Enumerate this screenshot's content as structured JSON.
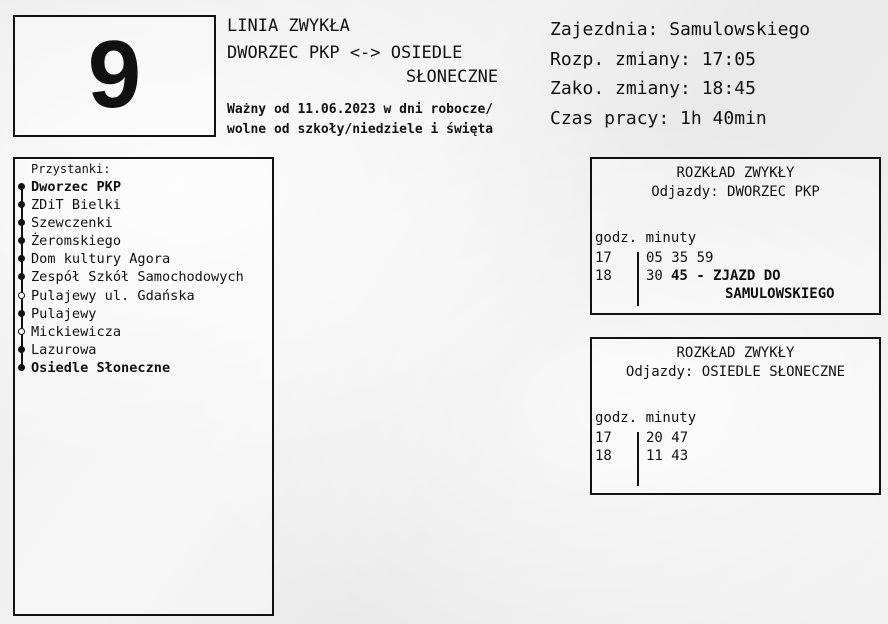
{
  "line": {
    "number": "9",
    "type": "LINIA ZWYKŁA",
    "route_line1": "DWORZEC PKP <-> OSIEDLE",
    "route_line2": "SŁONECZNE",
    "validity_line1": "Ważny od 11.06.2023 w dni robocze/",
    "validity_line2": "wolne od szkoły/niedziele i święta"
  },
  "shift": {
    "depot": "Zajezdnia: Samulowskiego",
    "start": "Rozp. zmiany: 17:05",
    "end": "Zako. zmiany: 18:45",
    "work_time": "Czas pracy: 1h 40min"
  },
  "stops": {
    "title": "Przystanki:",
    "items": [
      {
        "name": "Dworzec PKP",
        "bold": true,
        "on_request": false
      },
      {
        "name": "ZDiT Bielki",
        "bold": false,
        "on_request": false
      },
      {
        "name": "Szewczenki",
        "bold": false,
        "on_request": false
      },
      {
        "name": "Żeromskiego",
        "bold": false,
        "on_request": false
      },
      {
        "name": "Dom kultury Agora",
        "bold": false,
        "on_request": false
      },
      {
        "name": "Zespół Szkół Samochodowych",
        "bold": false,
        "on_request": false
      },
      {
        "name": "Pulajewy ul. Gdańska",
        "bold": false,
        "on_request": true
      },
      {
        "name": "Pulajewy",
        "bold": false,
        "on_request": false
      },
      {
        "name": "Mickiewicza",
        "bold": false,
        "on_request": true
      },
      {
        "name": "Lazurowa",
        "bold": false,
        "on_request": false
      },
      {
        "name": "Osiedle Słoneczne",
        "bold": true,
        "on_request": false
      }
    ]
  },
  "timetables": [
    {
      "title": "ROZKŁAD ZWYKŁY",
      "direction": "Odjazdy: DWORZEC PKP",
      "columns": "godz. minuty",
      "rows": [
        {
          "hour": "17",
          "minutes": "05 35 59"
        },
        {
          "hour": "18",
          "minutes": "30"
        }
      ],
      "note_line1": "45 - ZJAZD DO",
      "note_line2": "SAMULOWSKIEGO"
    },
    {
      "title": "ROZKŁAD ZWYKŁY",
      "direction": "Odjazdy: OSIEDLE SŁONECZNE",
      "columns": "godz. minuty",
      "rows": [
        {
          "hour": "17",
          "minutes": "20 47"
        },
        {
          "hour": "18",
          "minutes": "11 43"
        }
      ]
    }
  ]
}
